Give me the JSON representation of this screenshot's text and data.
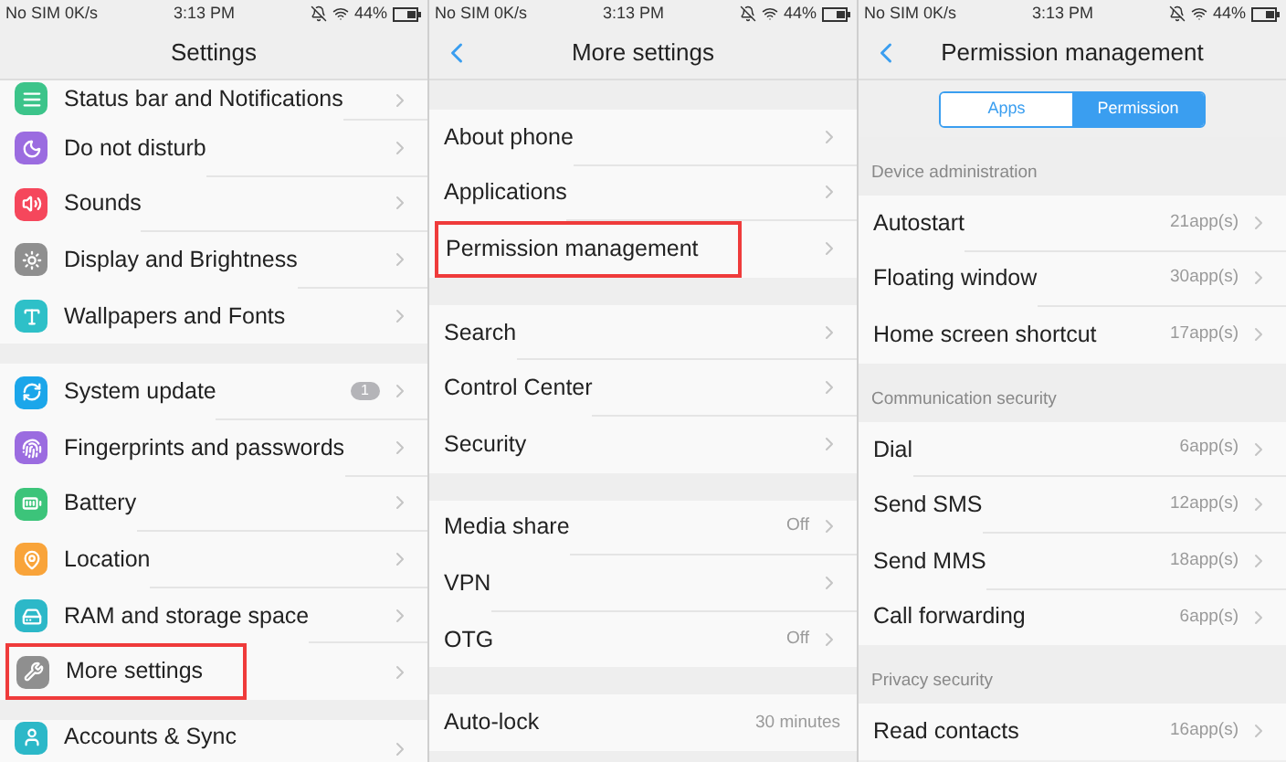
{
  "screens": [
    {
      "status_bar": {
        "carrier": "No SIM 0K/s",
        "time": "3:13 PM",
        "battery": "44%"
      },
      "header": {
        "title": "Settings"
      },
      "groups": [
        {
          "items": [
            {
              "label": "Status bar and Notifications",
              "color": "#3cc48a",
              "chevron": true,
              "highlighted": false
            },
            {
              "label": "Do not disturb",
              "color": "#9b6ce0",
              "chevron": true,
              "highlighted": false
            },
            {
              "label": "Sounds",
              "color": "#f5475c",
              "chevron": true,
              "highlighted": false
            },
            {
              "label": "Display and Brightness",
              "color": "#8f8f8f",
              "chevron": true,
              "highlighted": false
            },
            {
              "label": "Wallpapers and Fonts",
              "color": "#2ec0c8",
              "chevron": true,
              "highlighted": false
            }
          ]
        },
        {
          "items": [
            {
              "label": "System update",
              "color": "#1ba6ea",
              "badge": "1",
              "chevron": true,
              "highlighted": false
            },
            {
              "label": "Fingerprints and passwords",
              "color": "#9b6ce0",
              "chevron": true,
              "highlighted": false
            },
            {
              "label": "Battery",
              "color": "#3cc47a",
              "chevron": true,
              "highlighted": false
            },
            {
              "label": "Location",
              "color": "#f9a43a",
              "chevron": true,
              "highlighted": false
            },
            {
              "label": "RAM and storage space",
              "color": "#2cb8c8",
              "chevron": true,
              "highlighted": false
            },
            {
              "label": "More settings",
              "color": "#8f8f8f",
              "chevron": true,
              "highlighted": true
            }
          ]
        },
        {
          "items": [
            {
              "label": "Accounts & Sync",
              "color": "#2cb8c8",
              "chevron": true,
              "highlighted": false
            }
          ]
        }
      ]
    },
    {
      "status_bar": {
        "carrier": "No SIM 0K/s",
        "time": "3:13 PM",
        "battery": "44%"
      },
      "header": {
        "title": "More settings",
        "back": true
      },
      "groups": [
        {
          "items": [
            {
              "label": "About phone",
              "chevron": true,
              "highlighted": false
            },
            {
              "label": "Applications",
              "chevron": true,
              "highlighted": false
            },
            {
              "label": "Permission management",
              "chevron": true,
              "highlighted": true
            }
          ]
        },
        {
          "items": [
            {
              "label": "Search",
              "chevron": true,
              "highlighted": false
            },
            {
              "label": "Control Center",
              "chevron": true,
              "highlighted": false
            },
            {
              "label": "Security",
              "chevron": true,
              "highlighted": false
            }
          ]
        },
        {
          "items": [
            {
              "label": "Media share",
              "value": "Off",
              "chevron": true,
              "highlighted": false
            },
            {
              "label": "VPN",
              "chevron": true,
              "highlighted": false
            },
            {
              "label": "OTG",
              "value": "Off",
              "chevron": true,
              "highlighted": false
            }
          ]
        },
        {
          "items": [
            {
              "label": "Auto-lock",
              "value": "30 minutes",
              "chevron": false,
              "highlighted": false
            }
          ]
        }
      ]
    },
    {
      "status_bar": {
        "carrier": "No SIM 0K/s",
        "time": "3:13 PM",
        "battery": "44%"
      },
      "header": {
        "title": "Permission management",
        "back": true
      },
      "segments": [
        {
          "label": "Apps",
          "selected": false
        },
        {
          "label": "Permission",
          "selected": true
        }
      ],
      "groups": [
        {
          "title": "Device administration",
          "items": [
            {
              "label": "Autostart",
              "value": "21app(s)",
              "chevron": true,
              "highlighted": false
            },
            {
              "label": "Floating window",
              "value": "30app(s)",
              "chevron": true,
              "highlighted": false
            },
            {
              "label": "Home screen shortcut",
              "value": "17app(s)",
              "chevron": true,
              "highlighted": false
            }
          ]
        },
        {
          "title": "Communication security",
          "items": [
            {
              "label": "Dial",
              "value": "6app(s)",
              "chevron": true,
              "highlighted": false
            },
            {
              "label": "Send SMS",
              "value": "12app(s)",
              "chevron": true,
              "highlighted": false
            },
            {
              "label": "Send MMS",
              "value": "18app(s)",
              "chevron": true,
              "highlighted": false
            },
            {
              "label": "Call forwarding",
              "value": "6app(s)",
              "chevron": true,
              "highlighted": false
            }
          ]
        },
        {
          "title": "Privacy security",
          "items": [
            {
              "label": "Read contacts",
              "value": "16app(s)",
              "chevron": true,
              "highlighted": false
            }
          ]
        }
      ]
    }
  ]
}
